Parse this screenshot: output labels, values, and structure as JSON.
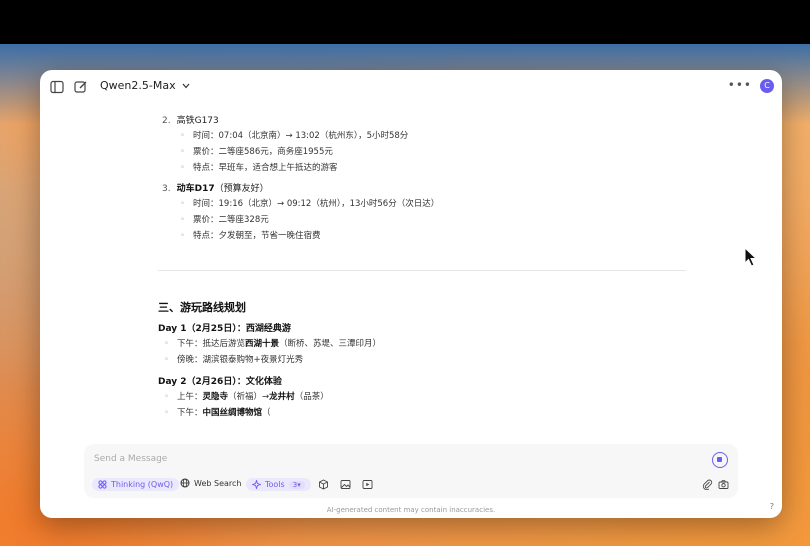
{
  "topbar": {
    "model_name": "Qwen2.5-Max",
    "avatar_letter": "C"
  },
  "train_items": [
    {
      "num": "2.",
      "title": "高铁G173",
      "title_note": "",
      "lines": [
        "时间：07:04（北京南）→ 13:02（杭州东），5小时58分",
        "票价：二等座586元，商务座1955元",
        "特点：早班车，适合想上午抵达的游客"
      ]
    },
    {
      "num": "3.",
      "title": "动车D17",
      "title_note": "（预算友好）",
      "lines": [
        "时间：19:16（北京）→ 09:12（杭州），13小时56分（次日达）",
        "票价：二等座328元",
        "特点：夕发朝至，节省一晚住宿费"
      ]
    }
  ],
  "section": {
    "heading": "三、游玩路线规划",
    "day1": {
      "title": "Day 1（2月25日）：西湖经典游",
      "l1_pre": "下午：抵达后游览",
      "l1_bold": "西湖十景",
      "l1_post": "（断桥、苏堤、三潭印月）",
      "l2": "傍晚：湖滨银泰购物+夜景灯光秀"
    },
    "day2": {
      "title": "Day 2（2月26日）：文化体验",
      "l1_pre": "上午：",
      "l1_b1": "灵隐寺",
      "l1_mid": "（祈福）→",
      "l1_b2": "龙井村",
      "l1_post": "（品茶）",
      "l2_pre": "下午：",
      "l2_bold": "中国丝绸博物馆",
      "l2_post": "（"
    }
  },
  "input": {
    "placeholder": "Send a Message",
    "thinking_label": "Thinking (QwQ)",
    "web_search_label": "Web Search",
    "tools_label": "Tools",
    "tools_count": "3"
  },
  "footer": {
    "disclaimer": "AI-generated content may contain inaccuracies.",
    "help": "?"
  },
  "colors": {
    "accent": "#6b5cf0"
  }
}
